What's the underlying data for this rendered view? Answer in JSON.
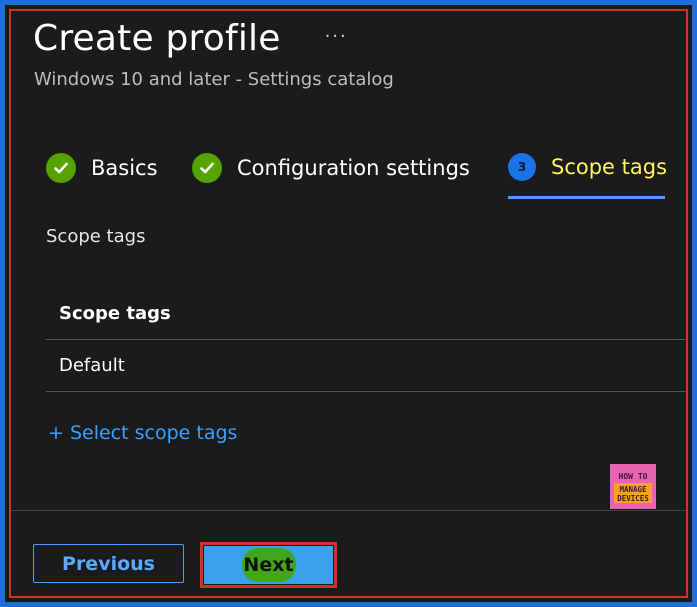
{
  "header": {
    "title": "Create profile",
    "more_label": "···",
    "subtitle": "Windows 10 and later - Settings catalog"
  },
  "steps": [
    {
      "label": "Basics",
      "state": "complete",
      "icon": "check-icon"
    },
    {
      "label": "Configuration settings",
      "state": "complete",
      "icon": "check-icon"
    },
    {
      "label": "Scope tags",
      "state": "active",
      "number": "3"
    }
  ],
  "main": {
    "section_label": "Scope tags",
    "table": {
      "header": "Scope tags",
      "rows": [
        "Default"
      ]
    },
    "select_link": "+ Select scope tags"
  },
  "logo": {
    "line1": "HOW TO",
    "line2": "MANAGE",
    "line3": "DEVICES"
  },
  "footer": {
    "previous_label": "Previous",
    "next_label": "Next"
  },
  "colors": {
    "background": "#1b1b1b",
    "accent_blue": "#1a73e8",
    "complete_green": "#57a300",
    "active_step_text": "#fff45c",
    "link_blue": "#3aa0ff",
    "annotation_red": "#d32f2f"
  }
}
